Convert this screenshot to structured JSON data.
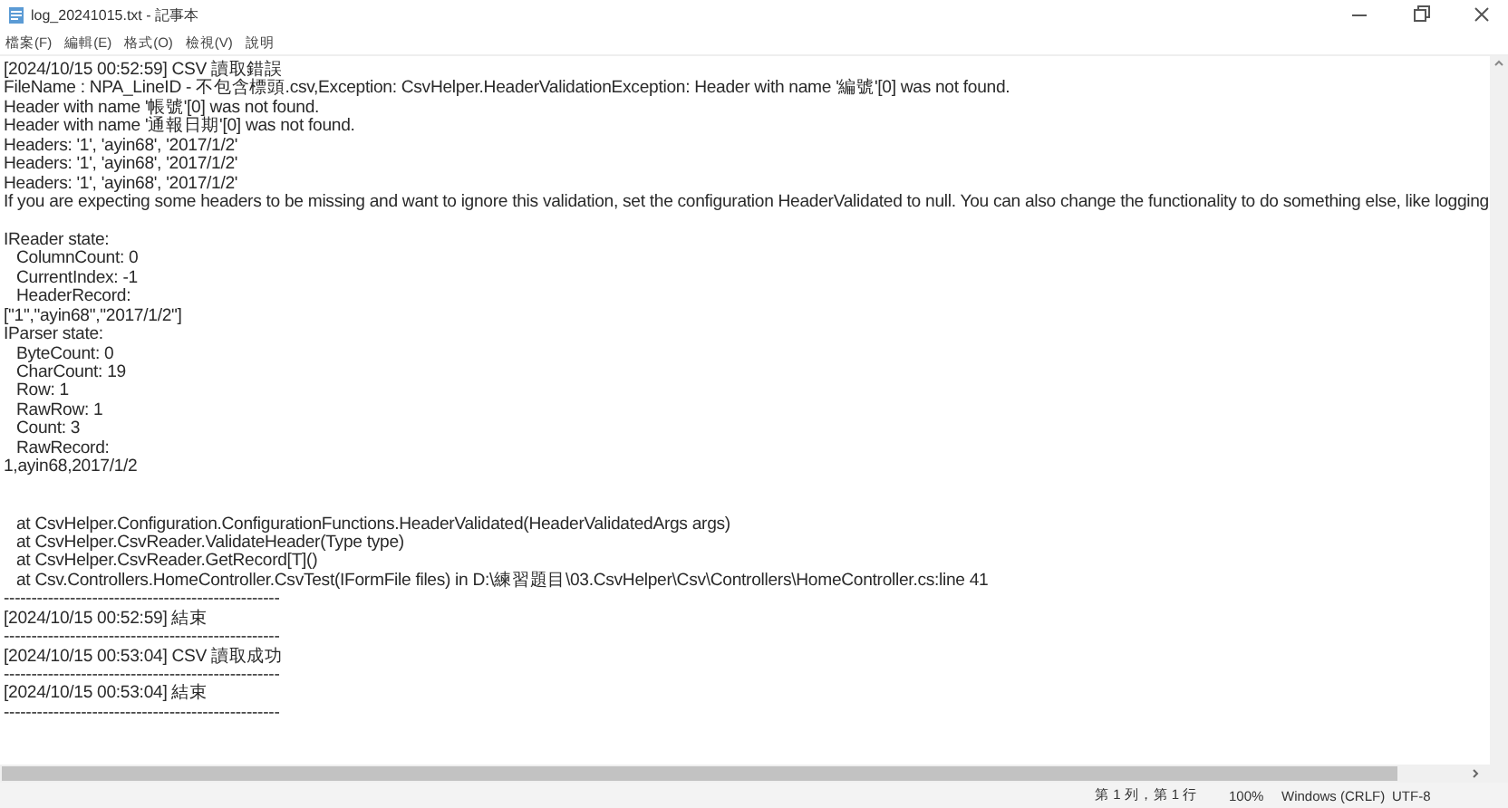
{
  "window": {
    "title": "log_20241015.txt - 記事本"
  },
  "menu": [
    "檔案(F)",
    "編輯(E)",
    "格式(O)",
    "檢視(V)",
    "說明"
  ],
  "lines": [
    {
      "kind": "text",
      "indent": false,
      "text": "[2024/10/15 00:52:59] CSV 讀取錯誤"
    },
    {
      "kind": "text",
      "indent": false,
      "text": "FileName : NPA_LineID - 不包含標頭.csv,Exception: CsvHelper.HeaderValidationException: Header with name '編號'[0] was not found."
    },
    {
      "kind": "text",
      "indent": false,
      "text": "Header with name '帳號'[0] was not found."
    },
    {
      "kind": "text",
      "indent": false,
      "text": "Header with name '通報日期'[0] was not found."
    },
    {
      "kind": "text",
      "indent": false,
      "text": "Headers: '1', 'ayin68', '2017/1/2'"
    },
    {
      "kind": "text",
      "indent": false,
      "text": "Headers: '1', 'ayin68', '2017/1/2'"
    },
    {
      "kind": "text",
      "indent": false,
      "text": "Headers: '1', 'ayin68', '2017/1/2'"
    },
    {
      "kind": "text",
      "indent": false,
      "text": "If you are expecting some headers to be missing and want to ignore this validation, set the configuration HeaderValidated to null. You can also change the functionality to do something else, like logging"
    },
    {
      "kind": "blank"
    },
    {
      "kind": "text",
      "indent": false,
      "text": "IReader state:"
    },
    {
      "kind": "text",
      "indent": true,
      "text": "ColumnCount: 0"
    },
    {
      "kind": "text",
      "indent": true,
      "text": "CurrentIndex: -1"
    },
    {
      "kind": "text",
      "indent": true,
      "text": "HeaderRecord:"
    },
    {
      "kind": "text",
      "indent": false,
      "text": "[\"1\",\"ayin68\",\"2017/1/2\"]"
    },
    {
      "kind": "text",
      "indent": false,
      "text": "IParser state:"
    },
    {
      "kind": "text",
      "indent": true,
      "text": "ByteCount: 0"
    },
    {
      "kind": "text",
      "indent": true,
      "text": "CharCount: 19"
    },
    {
      "kind": "text",
      "indent": true,
      "text": "Row: 1"
    },
    {
      "kind": "text",
      "indent": true,
      "text": "RawRow: 1"
    },
    {
      "kind": "text",
      "indent": true,
      "text": "Count: 3"
    },
    {
      "kind": "text",
      "indent": true,
      "text": "RawRecord:"
    },
    {
      "kind": "text",
      "indent": false,
      "text": "1,ayin68,2017/1/2"
    },
    {
      "kind": "blank"
    },
    {
      "kind": "blank"
    },
    {
      "kind": "text",
      "indent": true,
      "text": "at CsvHelper.Configuration.ConfigurationFunctions.HeaderValidated(HeaderValidatedArgs args)"
    },
    {
      "kind": "text",
      "indent": true,
      "text": "at CsvHelper.CsvReader.ValidateHeader(Type type)"
    },
    {
      "kind": "text",
      "indent": true,
      "text": "at CsvHelper.CsvReader.GetRecord[T]()"
    },
    {
      "kind": "text",
      "indent": true,
      "text": "at Csv.Controllers.HomeController.CsvTest(IFormFile files) in D:\\練習題目\\03.CsvHelper\\Csv\\Controllers\\HomeController.cs:line 41"
    },
    {
      "kind": "text",
      "indent": false,
      "text": "--------------------------------------------------"
    },
    {
      "kind": "text",
      "indent": false,
      "text": "[2024/10/15 00:52:59] 結束"
    },
    {
      "kind": "text",
      "indent": false,
      "text": "--------------------------------------------------"
    },
    {
      "kind": "text",
      "indent": false,
      "text": "[2024/10/15 00:53:04] CSV 讀取成功"
    },
    {
      "kind": "text",
      "indent": false,
      "text": "--------------------------------------------------"
    },
    {
      "kind": "text",
      "indent": false,
      "text": "[2024/10/15 00:53:04] 結束"
    },
    {
      "kind": "text",
      "indent": false,
      "text": "--------------------------------------------------"
    }
  ],
  "status_bar": {
    "position": "第 1 列，第 1 行",
    "zoom": "100%",
    "line_ending": "Windows (CRLF)",
    "encoding": "UTF-8"
  }
}
